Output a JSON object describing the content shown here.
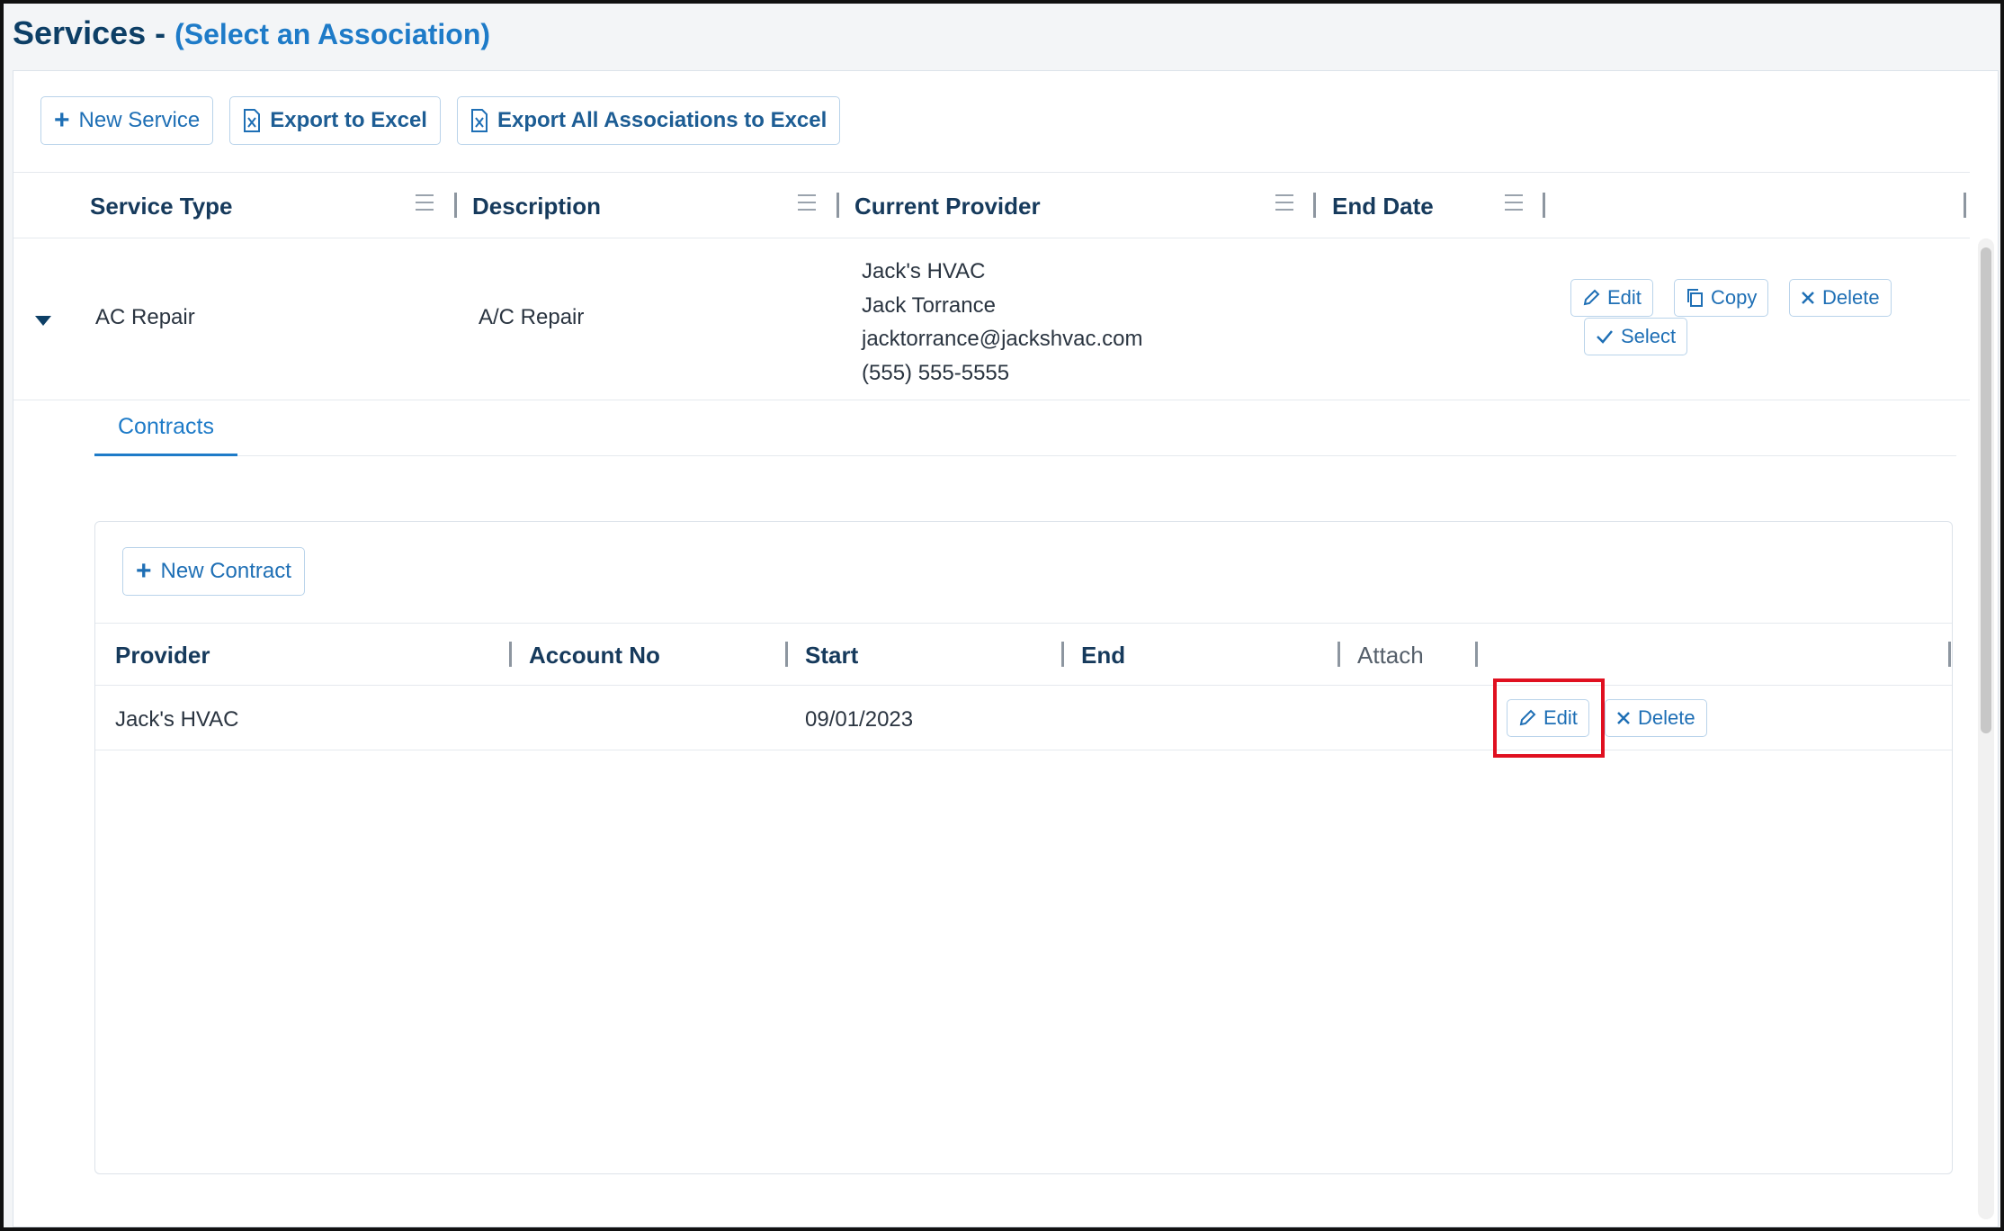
{
  "header": {
    "title": "Services -",
    "subtitle": "(Select an Association)"
  },
  "toolbar": {
    "new_service": "New Service",
    "export_excel": "Export to Excel",
    "export_all": "Export All Associations to Excel"
  },
  "grid": {
    "columns": [
      "Service Type",
      "Description",
      "Current Provider",
      "End Date"
    ],
    "rows": [
      {
        "service_type": "AC Repair",
        "description": "A/C Repair",
        "provider": [
          "Jack's HVAC",
          "Jack Torrance",
          "jacktorrance@jackshvac.com",
          "(555) 555-5555"
        ],
        "end_date": "",
        "actions": {
          "edit": "Edit",
          "copy": "Copy",
          "delete": "Delete",
          "select": "Select"
        }
      }
    ]
  },
  "tabs": {
    "contracts": "Contracts"
  },
  "contracts": {
    "new_contract": "New Contract",
    "columns": [
      "Provider",
      "Account No",
      "Start",
      "End",
      "Attach"
    ],
    "rows": [
      {
        "provider": "Jack's HVAC",
        "account_no": "",
        "start": "09/01/2023",
        "end": "",
        "attach": "",
        "edit": "Edit",
        "delete": "Delete"
      }
    ]
  },
  "colors": {
    "accent": "#1e7bc8",
    "heading": "#0d3f66",
    "highlight": "#e01020"
  }
}
